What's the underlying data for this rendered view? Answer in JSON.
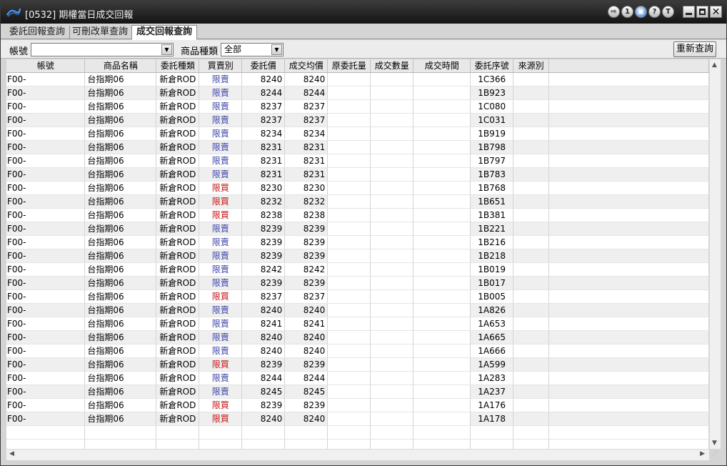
{
  "window": {
    "title": "[0532] 期權當日成交回報",
    "controls": [
      "⇨",
      "1",
      "▣",
      "?",
      "T"
    ]
  },
  "tabs": [
    {
      "label": "委託回報查詢",
      "active": false
    },
    {
      "label": "可刪改單查詢",
      "active": false
    },
    {
      "label": "成交回報查詢",
      "active": true
    }
  ],
  "filter": {
    "account_label": "帳號",
    "account_value": "",
    "product_type_label": "商品種類",
    "product_type_value": "全部",
    "reset_label": "重新查詢"
  },
  "table": {
    "headers": [
      "帳號",
      "商品名稱",
      "委託種類",
      "買賣別",
      "委託價",
      "成交均價",
      "原委託量",
      "成交數量",
      "成交時間",
      "委託序號",
      "來源別"
    ],
    "rows": [
      [
        "F00-",
        "台指期06",
        "新倉ROD",
        "限賣",
        "8240",
        "8240",
        "",
        "",
        "",
        "1C366",
        ""
      ],
      [
        "F00-",
        "台指期06",
        "新倉ROD",
        "限賣",
        "8244",
        "8244",
        "",
        "",
        "",
        "1B923",
        ""
      ],
      [
        "F00-",
        "台指期06",
        "新倉ROD",
        "限賣",
        "8237",
        "8237",
        "",
        "",
        "",
        "1C080",
        ""
      ],
      [
        "F00-",
        "台指期06",
        "新倉ROD",
        "限賣",
        "8237",
        "8237",
        "",
        "",
        "",
        "1C031",
        ""
      ],
      [
        "F00-",
        "台指期06",
        "新倉ROD",
        "限賣",
        "8234",
        "8234",
        "",
        "",
        "",
        "1B919",
        ""
      ],
      [
        "F00-",
        "台指期06",
        "新倉ROD",
        "限賣",
        "8231",
        "8231",
        "",
        "",
        "",
        "1B798",
        ""
      ],
      [
        "F00-",
        "台指期06",
        "新倉ROD",
        "限賣",
        "8231",
        "8231",
        "",
        "",
        "",
        "1B797",
        ""
      ],
      [
        "F00-",
        "台指期06",
        "新倉ROD",
        "限賣",
        "8231",
        "8231",
        "",
        "",
        "",
        "1B783",
        ""
      ],
      [
        "F00-",
        "台指期06",
        "新倉ROD",
        "限買",
        "8230",
        "8230",
        "",
        "",
        "",
        "1B768",
        ""
      ],
      [
        "F00-",
        "台指期06",
        "新倉ROD",
        "限買",
        "8232",
        "8232",
        "",
        "",
        "",
        "1B651",
        ""
      ],
      [
        "F00-",
        "台指期06",
        "新倉ROD",
        "限買",
        "8238",
        "8238",
        "",
        "",
        "",
        "1B381",
        ""
      ],
      [
        "F00-",
        "台指期06",
        "新倉ROD",
        "限賣",
        "8239",
        "8239",
        "",
        "",
        "",
        "1B221",
        ""
      ],
      [
        "F00-",
        "台指期06",
        "新倉ROD",
        "限賣",
        "8239",
        "8239",
        "",
        "",
        "",
        "1B216",
        ""
      ],
      [
        "F00-",
        "台指期06",
        "新倉ROD",
        "限賣",
        "8239",
        "8239",
        "",
        "",
        "",
        "1B218",
        ""
      ],
      [
        "F00-",
        "台指期06",
        "新倉ROD",
        "限賣",
        "8242",
        "8242",
        "",
        "",
        "",
        "1B019",
        ""
      ],
      [
        "F00-",
        "台指期06",
        "新倉ROD",
        "限賣",
        "8239",
        "8239",
        "",
        "",
        "",
        "1B017",
        ""
      ],
      [
        "F00-",
        "台指期06",
        "新倉ROD",
        "限買",
        "8237",
        "8237",
        "",
        "",
        "",
        "1B005",
        ""
      ],
      [
        "F00-",
        "台指期06",
        "新倉ROD",
        "限賣",
        "8240",
        "8240",
        "",
        "",
        "",
        "1A826",
        ""
      ],
      [
        "F00-",
        "台指期06",
        "新倉ROD",
        "限賣",
        "8241",
        "8241",
        "",
        "",
        "",
        "1A653",
        ""
      ],
      [
        "F00-",
        "台指期06",
        "新倉ROD",
        "限賣",
        "8240",
        "8240",
        "",
        "",
        "",
        "1A665",
        ""
      ],
      [
        "F00-",
        "台指期06",
        "新倉ROD",
        "限賣",
        "8240",
        "8240",
        "",
        "",
        "",
        "1A666",
        ""
      ],
      [
        "F00-",
        "台指期06",
        "新倉ROD",
        "限買",
        "8239",
        "8239",
        "",
        "",
        "",
        "1A599",
        ""
      ],
      [
        "F00-",
        "台指期06",
        "新倉ROD",
        "限賣",
        "8244",
        "8244",
        "",
        "",
        "",
        "1A283",
        ""
      ],
      [
        "F00-",
        "台指期06",
        "新倉ROD",
        "限賣",
        "8245",
        "8245",
        "",
        "",
        "",
        "1A237",
        ""
      ],
      [
        "F00-",
        "台指期06",
        "新倉ROD",
        "限買",
        "8239",
        "8239",
        "",
        "",
        "",
        "1A176",
        ""
      ],
      [
        "F00-",
        "台指期06",
        "新倉ROD",
        "限買",
        "8240",
        "8240",
        "",
        "",
        "",
        "1A178",
        ""
      ]
    ]
  },
  "colors": {
    "sell": "#3a42a8",
    "buy": "#c41010"
  }
}
